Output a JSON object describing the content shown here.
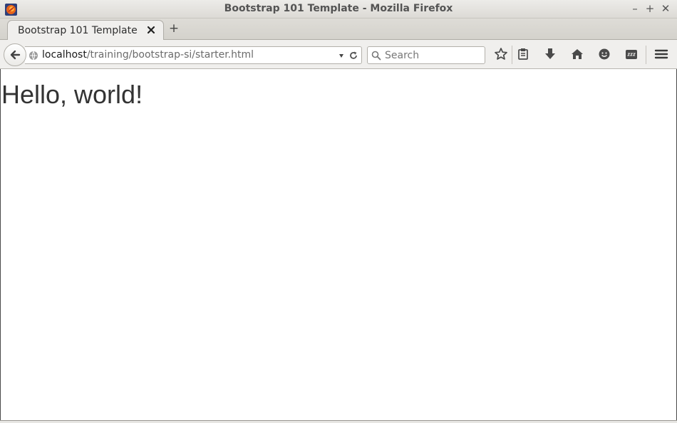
{
  "window": {
    "title": "Bootstrap 101 Template - Mozilla Firefox",
    "app_icon": "firefox-icon",
    "controls": {
      "minimize": "–",
      "maximize": "+",
      "close": "✕"
    }
  },
  "tabs": [
    {
      "label": "Bootstrap 101 Template",
      "active": true
    }
  ],
  "new_tab_label": "+",
  "navbar": {
    "url_host": "localhost",
    "url_path": "/training/bootstrap-si/starter.html",
    "search_placeholder": "Search",
    "buttons": [
      "bookmark-star-icon",
      "reading-list-icon",
      "download-icon",
      "home-icon",
      "hello-chat-icon",
      "pocket-sleep-icon",
      "hamburger-menu-icon"
    ]
  },
  "page": {
    "heading": "Hello, world!"
  },
  "colors": {
    "heading_text": "#333333",
    "chrome_bg": "#f0efed",
    "titlebar_text": "#545454"
  }
}
